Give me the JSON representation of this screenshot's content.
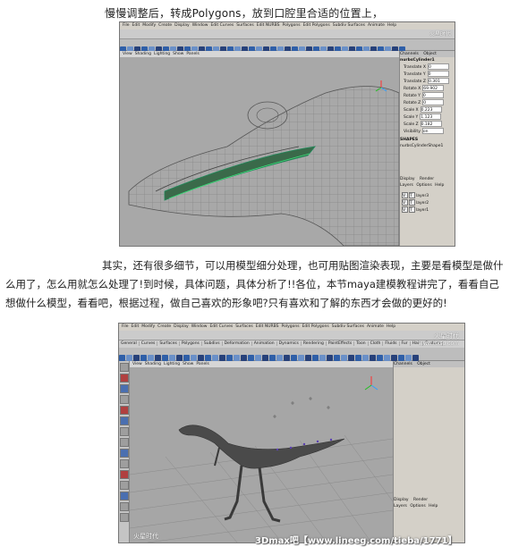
{
  "caption_top": "慢慢调整后，转成Polygons，放到口腔里合适的位置上，",
  "paragraph": "其实，还有很多细节，可以用模型细分处理，也可用贴图渲染表现，主要是看模型是做什么用了，怎么用就怎么处理了!到时候，具体问题，具体分析了!!各位，本节maya建模教程讲完了，看看自己想做什么模型，看看吧，根据过程，做自己喜欢的形象吧?只有喜欢和了解的东西才会做的更好的!",
  "screenshot1": {
    "menubar": [
      "File",
      "Edit",
      "Modify",
      "Create",
      "Display",
      "Window",
      "Edit Curves",
      "Surfaces",
      "Edit NURBS",
      "Polygons",
      "Edit Polygons",
      "Subdiv Surfaces",
      "Animate",
      "Help"
    ],
    "panel_menu": [
      "View",
      "Shading",
      "Lighting",
      "Show",
      "Panels"
    ],
    "channel_tabs": [
      "Channels",
      "Object"
    ],
    "object_name": "nurbsCylinder1",
    "attributes": [
      {
        "label": "Translate X",
        "value": "0"
      },
      {
        "label": "Translate Y",
        "value": "0"
      },
      {
        "label": "Translate Z",
        "value": "0.301"
      },
      {
        "label": "Rotate X",
        "value": "69.902"
      },
      {
        "label": "Rotate Y",
        "value": "0"
      },
      {
        "label": "Rotate Z",
        "value": "0"
      },
      {
        "label": "Scale X",
        "value": "0.223"
      },
      {
        "label": "Scale Y",
        "value": "1.123"
      },
      {
        "label": "Scale Z",
        "value": "0.182"
      },
      {
        "label": "Visibility",
        "value": "on"
      }
    ],
    "shapes_header": "SHAPES",
    "shape_name": "nurbsCylinderShape1",
    "display_options": [
      "Display",
      "Render"
    ],
    "layer_menu": [
      "Layers",
      "Options",
      "Help"
    ],
    "layers": [
      "layer3",
      "layer2",
      "layer1"
    ],
    "corner_watermark": "火星时代"
  },
  "screenshot2": {
    "mode_select": "Modeling",
    "menubar": [
      "File",
      "Edit",
      "Modify",
      "Create",
      "Display",
      "Window",
      "Edit Curves",
      "Surfaces",
      "Edit NURBS",
      "Polygons",
      "Edit Polygons",
      "Subdiv Surfaces",
      "Animate",
      "Help"
    ],
    "shelf_tabs": [
      "General",
      "Curves",
      "Surfaces",
      "Polygons",
      "Subdivs",
      "Deformation",
      "Animation",
      "Dynamics",
      "Rendering",
      "PaintEffects",
      "Toon",
      "Cloth",
      "Fluids",
      "Fur",
      "Hair",
      "Custom"
    ],
    "panel_menu": [
      "View",
      "Shading",
      "Lighting",
      "Show",
      "Panels"
    ],
    "channel_tabs": [
      "Channels",
      "Object"
    ],
    "display_options": [
      "Display",
      "Render"
    ],
    "layer_menu": [
      "Layers",
      "Options",
      "Help"
    ],
    "corner_watermark": "火星时代",
    "site_watermark": "www.hxsd.com",
    "bottom_left_watermark": "火星时代"
  },
  "footer_watermark": "3Dmax吧【www.lineeg.com/tieba/1771】"
}
